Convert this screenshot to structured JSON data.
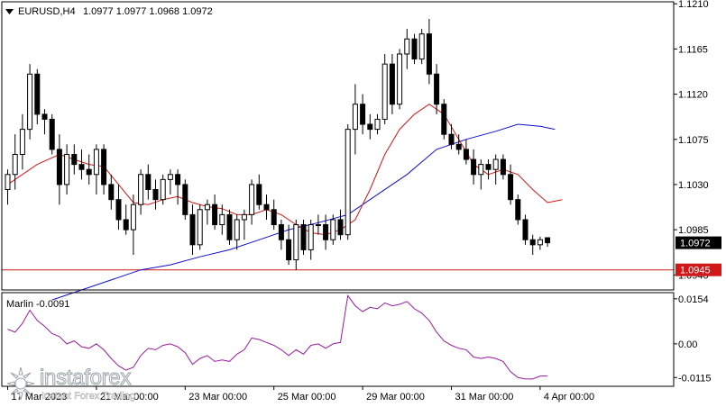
{
  "chart_data": [
    {
      "type": "candlestick",
      "symbol": "EURUSD,H4",
      "ohlc_header": "1.0977 1.0977 1.0968 1.0972",
      "ylim": [
        1.0925,
        1.1212
      ],
      "y_ticks": [
        "1.1210",
        "1.1165",
        "1.1120",
        "1.1075",
        "1.1030",
        "1.0985",
        "1.0940"
      ],
      "x_labels": [
        {
          "index": 0,
          "label": "17 Mar 2023"
        },
        {
          "index": 12,
          "label": "21 Mar 00:00"
        },
        {
          "index": 24,
          "label": "23 Mar 00:00"
        },
        {
          "index": 36,
          "label": "25 Mar 00:00"
        },
        {
          "index": 48,
          "label": "29 Mar 00:00"
        },
        {
          "index": 60,
          "label": "31 Mar 00:00"
        },
        {
          "index": 72,
          "label": "4 Apr 00:00"
        }
      ],
      "price_label": "1.0972",
      "level_label": "1.0945",
      "horizontal_level": 1.0945,
      "colors": {
        "up": "#ffffff",
        "down": "#000000",
        "fast_ma": "#d01818",
        "slow_ma": "#1010d0",
        "level": "#d01818",
        "grid": "#000000"
      },
      "candles": [
        [
          1.1025,
          1.1045,
          1.101,
          1.104
        ],
        [
          1.104,
          1.108,
          1.1025,
          1.106
        ],
        [
          1.106,
          1.11,
          1.1045,
          1.1085
        ],
        [
          1.1085,
          1.115,
          1.1075,
          1.114
        ],
        [
          1.114,
          1.1145,
          1.109,
          1.11
        ],
        [
          1.11,
          1.1105,
          1.108,
          1.1095
        ],
        [
          1.1095,
          1.11,
          1.106,
          1.1065
        ],
        [
          1.1065,
          1.108,
          1.101,
          1.103
        ],
        [
          1.103,
          1.107,
          1.102,
          1.106
        ],
        [
          1.106,
          1.107,
          1.104,
          1.105
        ],
        [
          1.105,
          1.1065,
          1.1035,
          1.1045
        ],
        [
          1.1045,
          1.106,
          1.103,
          1.104
        ],
        [
          1.104,
          1.107,
          1.102,
          1.1065
        ],
        [
          1.1065,
          1.107,
          1.102,
          1.103
        ],
        [
          1.103,
          1.104,
          1.1005,
          1.1015
        ],
        [
          1.1015,
          1.103,
          1.0985,
          1.0995
        ],
        [
          1.0995,
          1.101,
          1.098,
          1.0985
        ],
        [
          1.0985,
          1.102,
          1.096,
          1.101
        ],
        [
          1.101,
          1.1045,
          1.1,
          1.104
        ],
        [
          1.104,
          1.105,
          1.1015,
          1.1025
        ],
        [
          1.1025,
          1.1035,
          1.1005,
          1.1015
        ],
        [
          1.1015,
          1.104,
          1.101,
          1.1035
        ],
        [
          1.1035,
          1.1045,
          1.102,
          1.104
        ],
        [
          1.104,
          1.1045,
          1.101,
          1.103
        ],
        [
          1.103,
          1.1035,
          1.0995,
          1.1
        ],
        [
          1.1,
          1.101,
          1.096,
          1.097
        ],
        [
          1.097,
          1.101,
          1.0965,
          1.1005
        ],
        [
          1.1005,
          1.1015,
          1.099,
          1.101
        ],
        [
          1.101,
          1.102,
          1.0985,
          1.099
        ],
        [
          1.099,
          1.101,
          1.098,
          1.1
        ],
        [
          1.1,
          1.1005,
          1.097,
          1.0975
        ],
        [
          1.0975,
          1.1,
          1.0965,
          1.0995
        ],
        [
          1.0995,
          1.1005,
          1.0975,
          1.1
        ],
        [
          1.1,
          1.1035,
          1.099,
          1.103
        ],
        [
          1.103,
          1.104,
          1.1005,
          1.101
        ],
        [
          1.101,
          1.102,
          1.0995,
          1.1005
        ],
        [
          1.1005,
          1.1015,
          1.0985,
          1.099
        ],
        [
          1.099,
          1.0995,
          1.0965,
          1.0975
        ],
        [
          1.0975,
          1.099,
          1.095,
          1.0955
        ],
        [
          1.0955,
          1.0995,
          1.0945,
          1.099
        ],
        [
          1.099,
          1.0995,
          1.096,
          1.0965
        ],
        [
          1.0965,
          1.0995,
          1.0955,
          1.099
        ],
        [
          1.099,
          1.1,
          1.098,
          1.099
        ],
        [
          1.099,
          1.1,
          1.0965,
          1.0975
        ],
        [
          1.0975,
          1.1,
          1.097,
          1.0995
        ],
        [
          1.0995,
          1.1005,
          1.0975,
          1.098
        ],
        [
          1.098,
          1.109,
          1.0975,
          1.1085
        ],
        [
          1.1085,
          1.113,
          1.106,
          1.111
        ],
        [
          1.111,
          1.112,
          1.108,
          1.109
        ],
        [
          1.109,
          1.11,
          1.1075,
          1.1085
        ],
        [
          1.1085,
          1.11,
          1.108,
          1.1095
        ],
        [
          1.1095,
          1.116,
          1.109,
          1.115
        ],
        [
          1.115,
          1.116,
          1.11,
          1.111
        ],
        [
          1.111,
          1.1165,
          1.1105,
          1.116
        ],
        [
          1.116,
          1.1185,
          1.1145,
          1.1175
        ],
        [
          1.1175,
          1.118,
          1.115,
          1.1155
        ],
        [
          1.1155,
          1.1185,
          1.115,
          1.118
        ],
        [
          1.118,
          1.1195,
          1.113,
          1.114
        ],
        [
          1.114,
          1.115,
          1.11,
          1.111
        ],
        [
          1.111,
          1.1115,
          1.1075,
          1.108
        ],
        [
          1.108,
          1.109,
          1.1065,
          1.107
        ],
        [
          1.107,
          1.108,
          1.106,
          1.1065
        ],
        [
          1.1065,
          1.1075,
          1.105,
          1.1055
        ],
        [
          1.1055,
          1.1065,
          1.103,
          1.104
        ],
        [
          1.104,
          1.1055,
          1.1025,
          1.105
        ],
        [
          1.105,
          1.1055,
          1.1035,
          1.1045
        ],
        [
          1.1045,
          1.106,
          1.103,
          1.1055
        ],
        [
          1.1055,
          1.106,
          1.1035,
          1.104
        ],
        [
          1.104,
          1.105,
          1.101,
          1.1015
        ],
        [
          1.1015,
          1.102,
          1.099,
          1.0995
        ],
        [
          1.0995,
          1.1,
          1.097,
          1.0975
        ],
        [
          1.0975,
          1.098,
          1.096,
          1.097
        ],
        [
          1.097,
          1.0978,
          1.0965,
          1.0975
        ],
        [
          1.0977,
          1.0977,
          1.0968,
          1.0972
        ]
      ],
      "fast_ma": [
        [
          0,
          1.103
        ],
        [
          4,
          1.105
        ],
        [
          7,
          1.106
        ],
        [
          9,
          1.1055
        ],
        [
          11,
          1.105
        ],
        [
          13,
          1.1048
        ],
        [
          15,
          1.103
        ],
        [
          17,
          1.1012
        ],
        [
          19,
          1.101
        ],
        [
          21,
          1.1015
        ],
        [
          23,
          1.1018
        ],
        [
          25,
          1.1012
        ],
        [
          27,
          1.1008
        ],
        [
          29,
          1.1006
        ],
        [
          31,
          1.1
        ],
        [
          33,
          1.1
        ],
        [
          35,
          1.1005
        ],
        [
          37,
          1.1
        ],
        [
          39,
          1.099
        ],
        [
          41,
          1.0982
        ],
        [
          43,
          1.098
        ],
        [
          45,
          1.0985
        ],
        [
          47,
          1.0995
        ],
        [
          49,
          1.1025
        ],
        [
          51,
          1.106
        ],
        [
          53,
          1.1085
        ],
        [
          55,
          1.11
        ],
        [
          57,
          1.111
        ],
        [
          59,
          1.11
        ],
        [
          61,
          1.1075
        ],
        [
          63,
          1.105
        ],
        [
          65,
          1.104
        ],
        [
          67,
          1.1045
        ],
        [
          69,
          1.104
        ],
        [
          71,
          1.1025
        ],
        [
          73,
          1.1012
        ],
        [
          75,
          1.1015
        ]
      ],
      "slow_ma": [
        [
          6,
          1.0915
        ],
        [
          10,
          1.0925
        ],
        [
          14,
          1.0935
        ],
        [
          18,
          1.0945
        ],
        [
          22,
          1.095
        ],
        [
          26,
          1.0958
        ],
        [
          30,
          1.0965
        ],
        [
          34,
          1.0975
        ],
        [
          38,
          1.0985
        ],
        [
          42,
          1.0992
        ],
        [
          46,
          1.1
        ],
        [
          50,
          1.102
        ],
        [
          54,
          1.104
        ],
        [
          58,
          1.1065
        ],
        [
          62,
          1.1075
        ],
        [
          66,
          1.1083
        ],
        [
          69,
          1.109
        ],
        [
          72,
          1.1088
        ],
        [
          74,
          1.1085
        ]
      ]
    },
    {
      "type": "line",
      "indicator_label": "Marlin -0.0091",
      "ylim": [
        -0.0145,
        0.0175
      ],
      "y_ticks": [
        "0.0154",
        "0.00",
        "-0.0115"
      ],
      "color": "#9a1aa0",
      "values": [
        0.005,
        0.004,
        0.007,
        0.0115,
        0.008,
        0.006,
        0.0035,
        0.0025,
        0.0,
        0.001,
        -0.001,
        -0.0015,
        0.0,
        -0.002,
        -0.005,
        -0.0075,
        -0.009,
        -0.008,
        -0.004,
        -0.0015,
        -0.002,
        -0.0005,
        0.0,
        -0.001,
        -0.003,
        -0.007,
        -0.005,
        -0.004,
        -0.006,
        -0.0055,
        -0.006,
        -0.0035,
        -0.002,
        0.002,
        0.0015,
        0.0005,
        -0.0005,
        -0.002,
        -0.004,
        -0.002,
        -0.0035,
        -0.0005,
        0.0,
        -0.0015,
        0.0,
        0.0005,
        0.0165,
        0.013,
        0.011,
        0.0125,
        0.012,
        0.014,
        0.013,
        0.0135,
        0.0145,
        0.012,
        0.0105,
        0.008,
        0.004,
        0.001,
        -0.0005,
        -0.0015,
        -0.002,
        -0.0045,
        -0.005,
        -0.0045,
        -0.005,
        -0.006,
        -0.0095,
        -0.0115,
        -0.012,
        -0.012,
        -0.011,
        -0.011
      ]
    }
  ],
  "logo": {
    "wordmark": "instaforex",
    "tagline": "Instant Forex Trading"
  }
}
